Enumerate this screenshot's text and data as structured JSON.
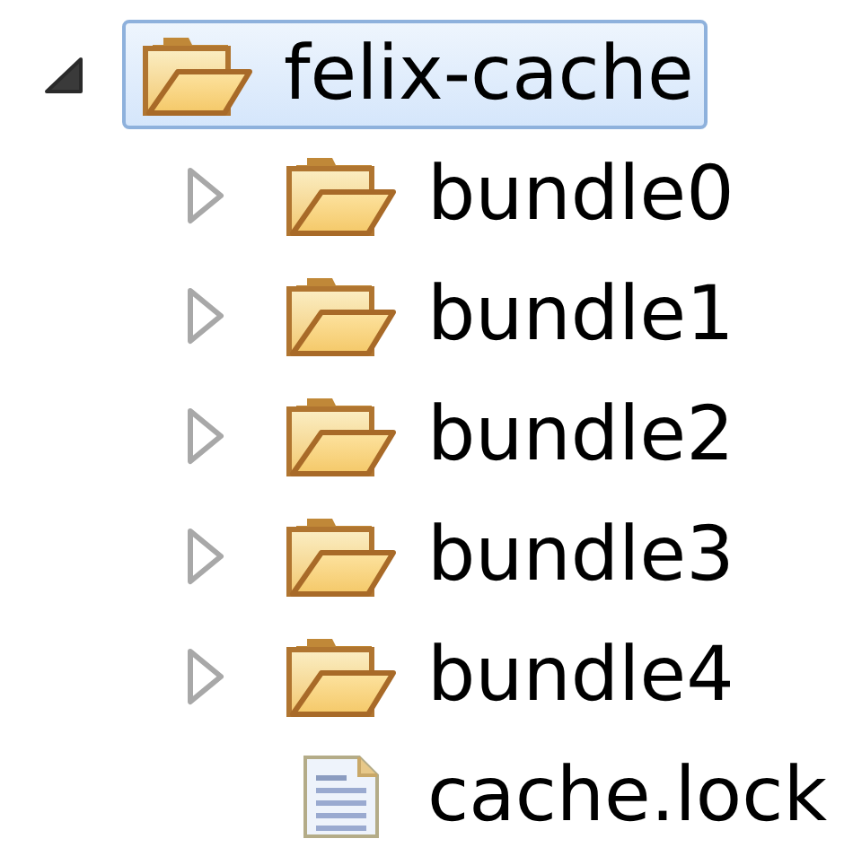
{
  "tree": [
    {
      "label": "felix-cache",
      "kind": "folder",
      "expanded": true,
      "selected": true,
      "children": [
        {
          "label": "bundle0",
          "kind": "folder",
          "expanded": false,
          "selected": false
        },
        {
          "label": "bundle1",
          "kind": "folder",
          "expanded": false,
          "selected": false
        },
        {
          "label": "bundle2",
          "kind": "folder",
          "expanded": false,
          "selected": false
        },
        {
          "label": "bundle3",
          "kind": "folder",
          "expanded": false,
          "selected": false
        },
        {
          "label": "bundle4",
          "kind": "folder",
          "expanded": false,
          "selected": false
        },
        {
          "label": "cache.lock",
          "kind": "file",
          "selected": false
        }
      ]
    }
  ]
}
